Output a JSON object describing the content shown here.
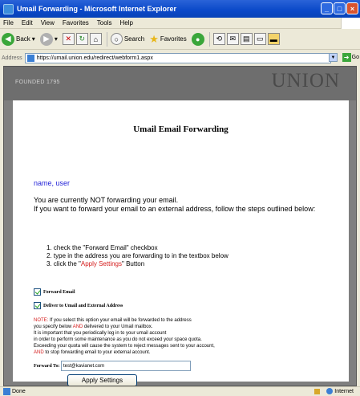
{
  "window": {
    "title": "Umail Forwarding - Microsoft Internet Explorer"
  },
  "menu": [
    "File",
    "Edit",
    "View",
    "Favorites",
    "Tools",
    "Help"
  ],
  "toolbar": {
    "back_label": "Back",
    "search_label": "Search",
    "favorites_label": "Favorites"
  },
  "address": {
    "label": "Address",
    "url": "https://umail.union.edu/redirect/webform1.aspx",
    "go_label": "Go"
  },
  "banner": {
    "founded": "FOUNDED 1795",
    "brand": "UNION"
  },
  "page": {
    "title": "Umail Email Forwarding",
    "user": "name, user",
    "intro_line1": "You are currently NOT forwarding your email.",
    "intro_line2": "If you want to forward your email to an external address, follow the steps outlined below:",
    "step1": "1.   check the \"Forward Email\" checkbox",
    "step2": "2.   type in the address you are forwarding to in the textbox below",
    "step3_prefix": "3.   click the \"",
    "step3_highlight": "Apply Settings",
    "step3_suffix": "\" Button",
    "forward_email_label": "Forward Email",
    "forward_email_checked": true,
    "deliver_label": "Deliver to Umail and External Address",
    "deliver_checked": true,
    "note_prefix": "NOTE:",
    "note_line1": " If you select this option your email will be forwarded to the address",
    "note_line2a": "you specify below ",
    "note_and1": "AND",
    "note_line2b": " delivered to your Umail mailbox.",
    "note_line3": "It is important that you periodically log in to your umail account",
    "note_line4": "in order to perform some maintenance as you do not exceed your space quota.",
    "note_line5": "Exceeding your quota will cause the system to reject messages sent to your account,",
    "note_and2": "AND",
    "note_line6": " to stop forwarding email to your external account.",
    "forward_to_label": "Forward To:",
    "forward_to_value": "test@kavianet.com",
    "apply_button": "Apply Settings"
  },
  "status": {
    "left": "Done",
    "zone": "Internet"
  }
}
